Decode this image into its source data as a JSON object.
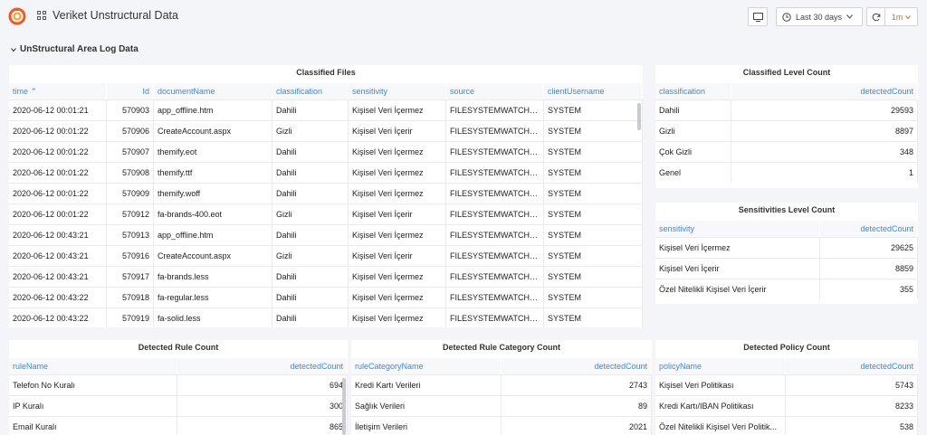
{
  "header": {
    "title": "Veriket Unstructural Data",
    "time_range": "Last 30 days",
    "refresh_interval": "1m"
  },
  "row": {
    "title": "UnStructural Area Log Data"
  },
  "classified_files": {
    "title": "Classified Files",
    "columns": [
      "time",
      "Id",
      "documentName",
      "classification",
      "sensitivity",
      "source",
      "clientUsername"
    ],
    "rows": [
      [
        "2020-06-12 00:01:21",
        "570903",
        "app_offline.htm",
        "Dahili",
        "Kişisel Veri İçermez",
        "FILESYSTEMWATCHER",
        "SYSTEM"
      ],
      [
        "2020-06-12 00:01:22",
        "570906",
        "CreateAccount.aspx",
        "Gizli",
        "Kişisel Veri İçerir",
        "FILESYSTEMWATCHER",
        "SYSTEM"
      ],
      [
        "2020-06-12 00:01:22",
        "570907",
        "themify.eot",
        "Dahili",
        "Kişisel Veri İçermez",
        "FILESYSTEMWATCHER",
        "SYSTEM"
      ],
      [
        "2020-06-12 00:01:22",
        "570908",
        "themify.ttf",
        "Dahili",
        "Kişisel Veri İçermez",
        "FILESYSTEMWATCHER",
        "SYSTEM"
      ],
      [
        "2020-06-12 00:01:22",
        "570909",
        "themify.woff",
        "Dahili",
        "Kişisel Veri İçermez",
        "FILESYSTEMWATCHER",
        "SYSTEM"
      ],
      [
        "2020-06-12 00:01:22",
        "570912",
        "fa-brands-400.eot",
        "Gizli",
        "Kişisel Veri İçerir",
        "FILESYSTEMWATCHER",
        "SYSTEM"
      ],
      [
        "2020-06-12 00:43:21",
        "570913",
        "app_offline.htm",
        "Dahili",
        "Kişisel Veri İçermez",
        "FILESYSTEMWATCHER",
        "SYSTEM"
      ],
      [
        "2020-06-12 00:43:21",
        "570916",
        "CreateAccount.aspx",
        "Gizli",
        "Kişisel Veri İçerir",
        "FILESYSTEMWATCHER",
        "SYSTEM"
      ],
      [
        "2020-06-12 00:43:21",
        "570917",
        "fa-brands.less",
        "Dahili",
        "Kişisel Veri İçermez",
        "FILESYSTEMWATCHER",
        "SYSTEM"
      ],
      [
        "2020-06-12 00:43:22",
        "570918",
        "fa-regular.less",
        "Dahili",
        "Kişisel Veri İçermez",
        "FILESYSTEMWATCHER",
        "SYSTEM"
      ],
      [
        "2020-06-12 00:43:22",
        "570919",
        "fa-solid.less",
        "Dahili",
        "Kişisel Veri İçermez",
        "FILESYSTEMWATCHER",
        "SYSTEM"
      ]
    ]
  },
  "classified_level_count": {
    "title": "Classified Level Count",
    "columns": [
      "classification",
      "detectedCount"
    ],
    "rows": [
      [
        "Dahili",
        "29593"
      ],
      [
        "Gizli",
        "8897"
      ],
      [
        "Çok Gizli",
        "348"
      ],
      [
        "Genel",
        "1"
      ]
    ]
  },
  "sensitivities_level_count": {
    "title": "Sensitivities Level Count",
    "columns": [
      "sensitivity",
      "detectedCount"
    ],
    "rows": [
      [
        "Kişisel Veri İçermez",
        "29625"
      ],
      [
        "Kişisel Veri İçerir",
        "8859"
      ],
      [
        "Özel Nitelikli Kişisel Veri İçerir",
        "355"
      ]
    ]
  },
  "detected_rule_count": {
    "title": "Detected Rule Count",
    "columns": [
      "ruleName",
      "detectedCount"
    ],
    "rows": [
      [
        "Telefon No Kuralı",
        "694"
      ],
      [
        "IP Kuralı",
        "300"
      ],
      [
        "Email Kuralı",
        "865"
      ]
    ]
  },
  "detected_rule_category_count": {
    "title": "Detected Rule Category Count",
    "columns": [
      "ruleCategoryName",
      "detectedCount"
    ],
    "rows": [
      [
        "Kredi Kartı Verileri",
        "2743"
      ],
      [
        "Sağlık Verileri",
        "89"
      ],
      [
        "İletişim Verileri",
        "2021"
      ]
    ]
  },
  "detected_policy_count": {
    "title": "Detected Policy Count",
    "columns": [
      "policyName",
      "detectedCount"
    ],
    "rows": [
      [
        "Kişisel Veri Politikası",
        "5743"
      ],
      [
        "Kredi Kartı/IBAN Politikası",
        "8233"
      ],
      [
        "Özel Nitelikli Kişisel Veri Politik...",
        "538"
      ]
    ]
  },
  "colors": {
    "accent": "#3a8ae0",
    "interval": "#e5682a",
    "logo": "#f05a28"
  }
}
